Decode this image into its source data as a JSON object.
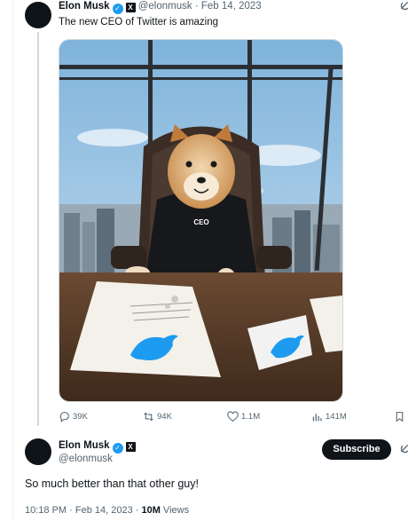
{
  "tweet1": {
    "author_name": "Elon Musk",
    "handle": "@elonmusk",
    "separator": "·",
    "date": "Feb 14, 2023",
    "text": "The new CEO of Twitter is amazing",
    "image_desc_label": "CEO",
    "actions": {
      "replies": "39K",
      "retweets": "94K",
      "likes": "1.1M",
      "views": "141M"
    }
  },
  "tweet2": {
    "author_name": "Elon Musk",
    "handle": "@elonmusk",
    "subscribe_label": "Subscribe",
    "text": "So much better than that other guy!",
    "time": "10:18 PM · Feb 14, 2023 · ",
    "views_count": "10M",
    "views_label": " Views"
  },
  "colors": {
    "accent": "#1d9bf0",
    "text": "#0f1419",
    "muted": "#536471",
    "border": "#cfd9de"
  },
  "icons": [
    "verified-badge-icon",
    "x-logo-icon",
    "grok-icon",
    "reply-icon",
    "retweet-icon",
    "like-icon",
    "views-icon",
    "bookmark-icon",
    "twitter-bird-icon"
  ]
}
